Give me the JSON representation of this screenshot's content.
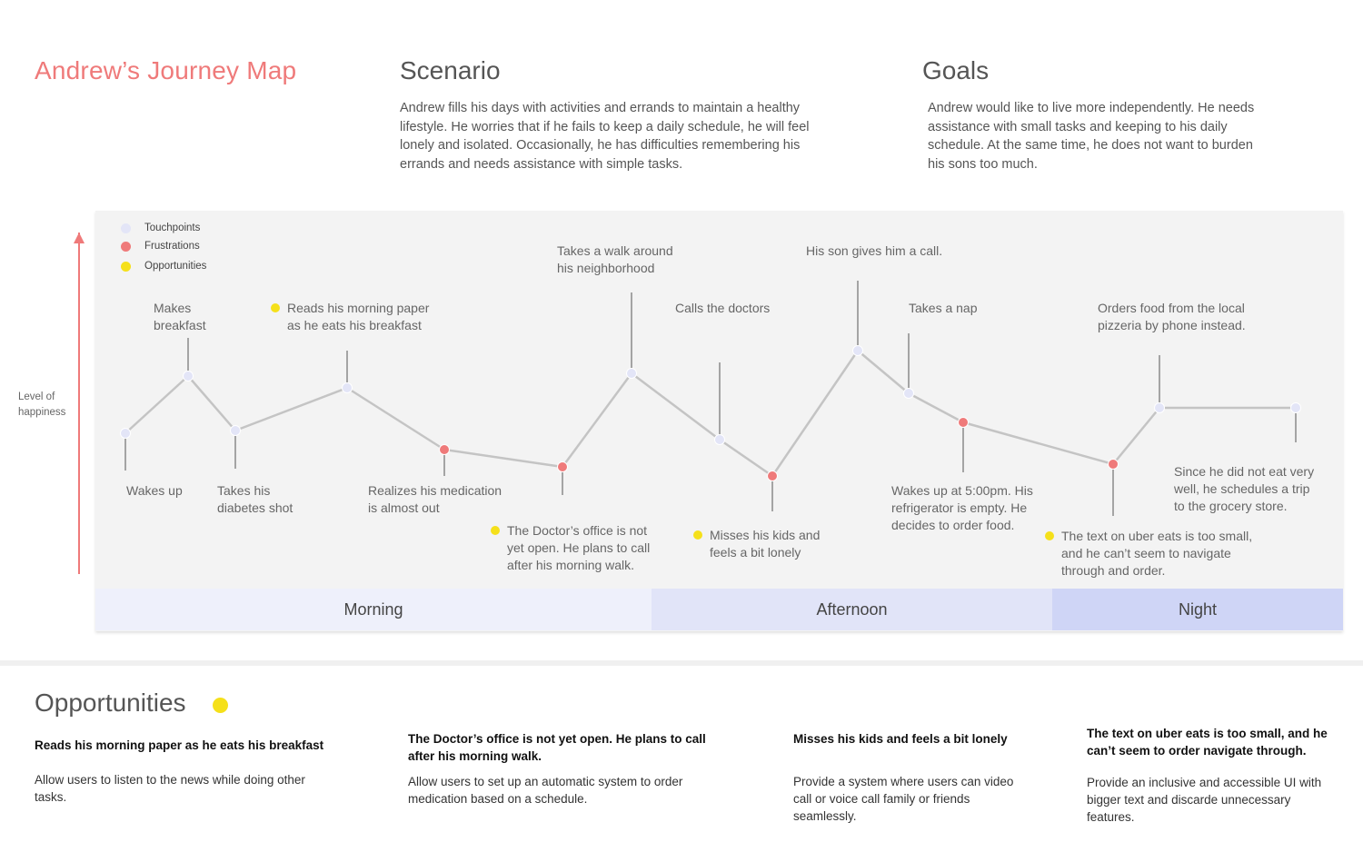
{
  "title": "Andrew’s Journey Map",
  "scenario": {
    "heading": "Scenario",
    "lines": [
      "Andrew fills his days with activities and errands to maintain a healthy",
      "lifestyle. He worries that if he fails to keep a daily schedule, he will feel",
      "lonely and isolated. Occasionally, he has difficulties remembering his",
      "errands and needs assistance with simple tasks."
    ]
  },
  "goals": {
    "heading": "Goals",
    "lines": [
      "Andrew would like to live more independently.  He needs",
      "assistance with small tasks and keeping to his daily",
      "schedule. At the same time, he does not want to burden",
      "his sons too much."
    ]
  },
  "axis_label": [
    "Level of",
    "happiness"
  ],
  "legend": [
    {
      "label": "Touchpoints",
      "color": "#e3e5f7"
    },
    {
      "label": "Frustrations",
      "color": "#ef7a7a"
    },
    {
      "label": "Opportunities",
      "color": "#f5e01a"
    }
  ],
  "periods": [
    "Morning",
    "Afternoon",
    "Night"
  ],
  "colors": {
    "line": "#c4c4c4",
    "touchpoint": "#e3e5f7",
    "frustration": "#ef7a7a",
    "opportunity": "#f5e01a",
    "accent": "#ef7a7a"
  },
  "journey": [
    {
      "type": "touchpoint",
      "label": [
        "Wakes up"
      ]
    },
    {
      "type": "touchpoint",
      "label": [
        "Makes",
        "breakfast"
      ]
    },
    {
      "type": "touchpoint",
      "label": [
        "Takes his",
        "diabetes shot"
      ]
    },
    {
      "type": "touchpoint",
      "label": [
        "Reads his morning paper",
        "as he eats his breakfast"
      ],
      "opportunity": true
    },
    {
      "type": "frustration",
      "label": [
        "Realizes his medication",
        "is  almost out"
      ]
    },
    {
      "type": "frustration",
      "label": [
        "The Doctor’s office is not",
        "yet open. He plans to call",
        "after his morning walk."
      ],
      "opportunity": true
    },
    {
      "type": "touchpoint",
      "label": [
        "Takes a walk around",
        "his neighborhood"
      ]
    },
    {
      "type": "touchpoint",
      "label": [
        "Calls the doctors"
      ]
    },
    {
      "type": "frustration",
      "label": [
        "Misses his kids and",
        "feels a bit lonely"
      ],
      "opportunity": true
    },
    {
      "type": "touchpoint",
      "label": [
        "His son gives him a call."
      ]
    },
    {
      "type": "touchpoint",
      "label": [
        "Takes a nap"
      ]
    },
    {
      "type": "frustration",
      "label": [
        "Wakes up at 5:00pm. His",
        "refrigerator is empty. He",
        "decides to order food."
      ]
    },
    {
      "type": "frustration",
      "label": [
        "The text on uber eats is too small,",
        "and he can’t seem to navigate",
        "through and order."
      ],
      "opportunity": true
    },
    {
      "type": "touchpoint",
      "label": [
        "Orders food from the local",
        "pizzeria by phone instead."
      ]
    },
    {
      "type": "touchpoint",
      "label": [
        "Since he did not eat very",
        "well, he schedules a trip",
        "to the grocery store."
      ]
    }
  ],
  "opportunities": {
    "heading": "Opportunities",
    "cards": [
      {
        "title": [
          "Reads his morning paper as he eats his breakfast"
        ],
        "body": [
          "Allow users to listen to the news while doing other",
          "tasks."
        ]
      },
      {
        "title": [
          "The Doctor’s office is not yet open. He plans to call",
          "after his morning walk."
        ],
        "body": [
          "Allow users to set up an automatic system to order",
          "medication based on a schedule."
        ]
      },
      {
        "title": [
          "Misses his kids and feels a bit lonely"
        ],
        "body": [
          "Provide a system where users can video",
          "call or voice call family or friends",
          "seamlessly."
        ]
      },
      {
        "title": [
          "The text on uber eats is too small, and he",
          "can’t seem to order navigate through."
        ],
        "body": [
          "Provide an inclusive and accessible UI with",
          "bigger text and discarde unnecessary",
          "features."
        ]
      }
    ]
  }
}
